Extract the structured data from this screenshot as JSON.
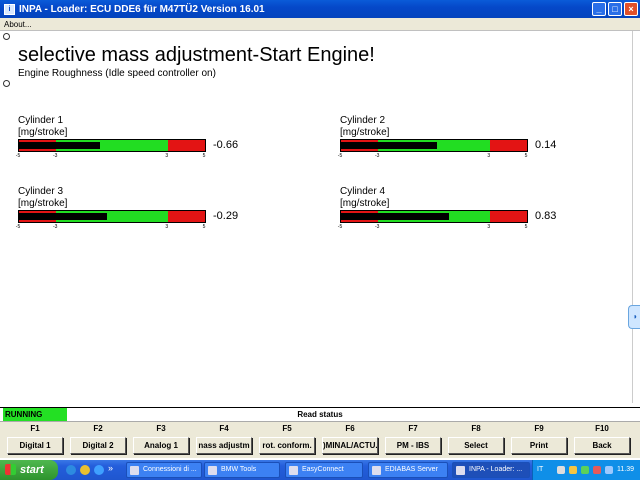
{
  "window": {
    "title": "INPA - Loader:  ECU DDE6 für M47TÜ2 Version 16.01",
    "minimize": "_",
    "maximize": "□",
    "close": "×"
  },
  "menu": {
    "about": "About..."
  },
  "main": {
    "title": "selective mass adjustment-Start Engine!",
    "subtitle": "Engine Roughness (Idle speed controller on)"
  },
  "cylinders": [
    {
      "name": "Cylinder 1",
      "unit": "[mg/stroke]",
      "value": "-0.66",
      "indicator_value": -0.66
    },
    {
      "name": "Cylinder 2",
      "unit": "[mg/stroke]",
      "value": "0.14",
      "indicator_value": 0.14
    },
    {
      "name": "Cylinder 3",
      "unit": "[mg/stroke]",
      "value": "-0.29",
      "indicator_value": -0.29
    },
    {
      "name": "Cylinder 4",
      "unit": "[mg/stroke]",
      "value": "0.83",
      "indicator_value": 0.83
    }
  ],
  "scale": {
    "min": -5,
    "max": 5,
    "ticks": [
      "-5",
      "-3",
      "3",
      "5"
    ],
    "tick_values": [
      -5,
      -3,
      3,
      5
    ]
  },
  "status": {
    "running": "RUNNING",
    "read_status": "Read status"
  },
  "fkeys": [
    {
      "key": "F1",
      "label": "Digital 1"
    },
    {
      "key": "F2",
      "label": "Digital 2"
    },
    {
      "key": "F3",
      "label": "Analog 1"
    },
    {
      "key": "F4",
      "label": "nass adjustm"
    },
    {
      "key": "F5",
      "label": "rot. conform."
    },
    {
      "key": "F6",
      "label": ")MINAL/ACTU."
    },
    {
      "key": "F7",
      "label": "PM - IBS"
    },
    {
      "key": "F8",
      "label": "Select"
    },
    {
      "key": "F9",
      "label": "Print"
    },
    {
      "key": "F10",
      "label": "Back"
    }
  ],
  "taskbar": {
    "start": "start",
    "quicklaunch_more": "»",
    "tasks": [
      {
        "label": "Connessioni di ...",
        "active": false
      },
      {
        "label": "BMW Tools",
        "active": false
      },
      {
        "label": "EasyConnect",
        "active": false
      },
      {
        "label": "EDIABAS Server",
        "active": false
      },
      {
        "label": "INPA - Loader: ...",
        "active": true
      }
    ],
    "language": "IT",
    "clock": "11.39"
  },
  "colors": {
    "red_zone": "#e31414",
    "green_zone": "#22dd22",
    "running": "#23e023"
  }
}
